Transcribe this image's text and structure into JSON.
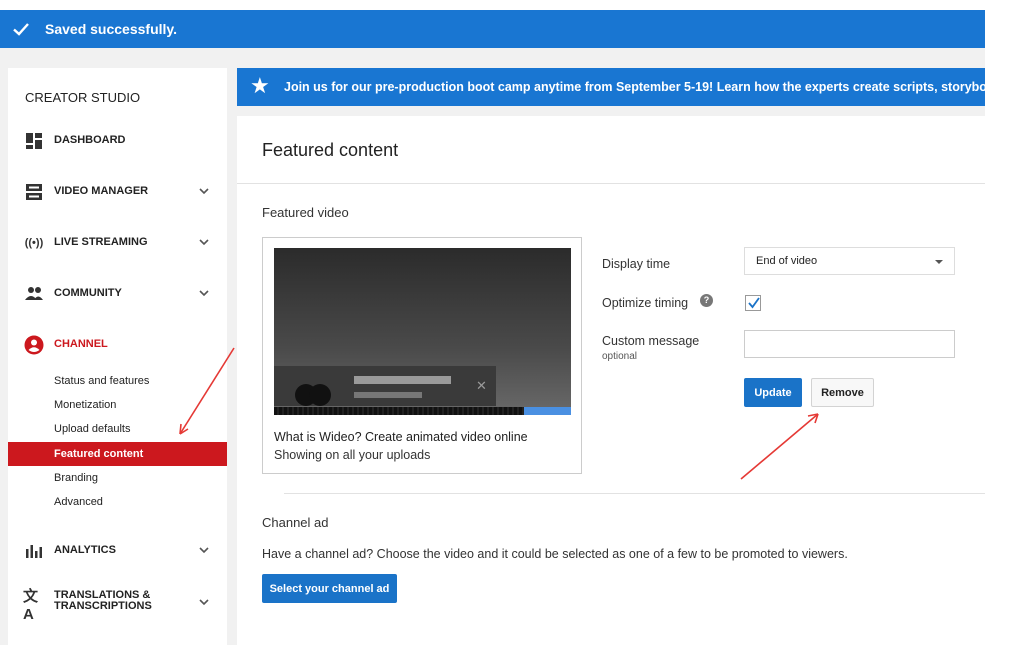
{
  "notification": {
    "message": "Saved successfully."
  },
  "sidebar": {
    "title": "CREATOR STUDIO",
    "items": [
      {
        "label": "DASHBOARD",
        "icon": "dashboard-icon"
      },
      {
        "label": "VIDEO MANAGER",
        "icon": "video-manager-icon"
      },
      {
        "label": "LIVE STREAMING",
        "icon": "live-streaming-icon"
      },
      {
        "label": "COMMUNITY",
        "icon": "community-icon"
      },
      {
        "label": "CHANNEL",
        "icon": "channel-icon",
        "color": "#cc181e"
      },
      {
        "label": "ANALYTICS",
        "icon": "analytics-icon"
      },
      {
        "label": "TRANSLATIONS & TRANSCRIPTIONS",
        "icon": "translate-icon"
      }
    ],
    "channel_subitems": [
      {
        "label": "Status and features"
      },
      {
        "label": "Monetization"
      },
      {
        "label": "Upload defaults"
      },
      {
        "label": "Featured content",
        "active": true
      },
      {
        "label": "Branding"
      },
      {
        "label": "Advanced"
      }
    ]
  },
  "banner": {
    "text": "Join us for our pre-production boot camp anytime from September 5-19! Learn how the experts create scripts, storyboa",
    "icon": "star-icon"
  },
  "main": {
    "title": "Featured content",
    "featured_video": {
      "section_label": "Featured video",
      "video_title": "What is Wideo? Create animated video online",
      "video_subtitle": "Showing on all your uploads",
      "display_time_label": "Display time",
      "display_time_value": "End of video",
      "optimize_timing_label": "Optimize timing",
      "optimize_timing_checked": true,
      "custom_message_label": "Custom message",
      "custom_message_optional": "optional",
      "custom_message_value": "",
      "update_label": "Update",
      "remove_label": "Remove"
    },
    "channel_ad": {
      "section_label": "Channel ad",
      "description": "Have a channel ad? Choose the video and it could be selected as one of a few to be promoted to viewers.",
      "button_label": "Select your channel ad"
    }
  },
  "colors": {
    "accent_blue": "#1976d2",
    "channel_red": "#cc181e",
    "annotation_red": "#e53935"
  }
}
